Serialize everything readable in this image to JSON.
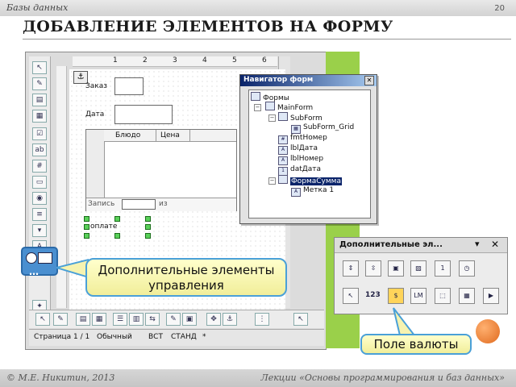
{
  "slide": {
    "section": "Базы данных",
    "page_number": "20",
    "title": "ДОБАВЛЕНИЕ ЭЛЕМЕНТОВ НА ФОРМУ",
    "author": "© М.Е. Никитин, 2013",
    "course": "Лекции «Основы программирования и баз данных»"
  },
  "ruler": {
    "marks": [
      "1",
      "2",
      "3",
      "4",
      "5",
      "6"
    ]
  },
  "form": {
    "label_order": "Заказ",
    "label_date": "Дата",
    "grid_col_dish": "Блюдо",
    "grid_col_price": "Цена",
    "grid_record": "Запись",
    "grid_of": "из",
    "label_payment": "оплате"
  },
  "navigator": {
    "title": "Навигатор форм",
    "close": "✕",
    "items": [
      "Формы",
      "MainForm",
      "SubForm",
      "SubForm_Grid",
      "fmtНомер",
      "lblДата",
      "lblНомер",
      "datДата",
      "ФормаСумма",
      "Метка 1"
    ],
    "selected": "ФормаСумма"
  },
  "status_bar": {
    "page": "Страница  1 / 1",
    "style": "Обычный",
    "insert": "ВСТ",
    "mode": "СТАНД",
    "modified": "*"
  },
  "additional_panel": {
    "title": "Дополнительные эл...",
    "numeric_label": "123",
    "lm_label": "LM"
  },
  "callouts": {
    "more_controls": "Дополнительные элементы управления",
    "currency_field": "Поле валюты"
  },
  "colors": {
    "accent_green": "#9ad04a",
    "callout_border": "#4aa0d8",
    "selection": "#0a246a"
  }
}
